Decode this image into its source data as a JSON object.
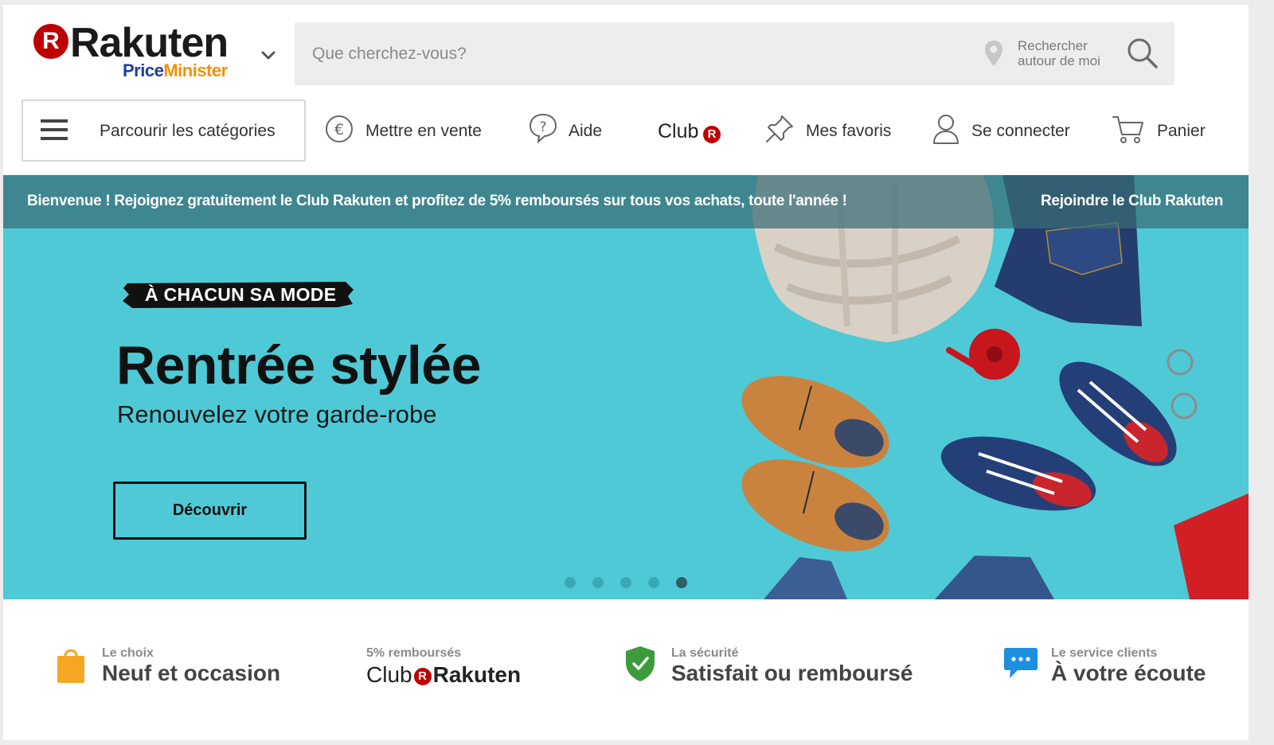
{
  "brand": {
    "logo_letter": "R",
    "logo_word": "Rakuten",
    "sub_part1": "Price",
    "sub_part2": "Minister",
    "colors": {
      "red": "#bf0000",
      "blue": "#1e3ea0",
      "orange": "#f29100",
      "banner": "#4fc9d6"
    }
  },
  "search": {
    "placeholder": "Que cherchez-vous?",
    "geo_line1": "Rechercher",
    "geo_line2": "autour de moi",
    "geo_icon": "location-pin-icon",
    "button_icon": "search-icon"
  },
  "nav": {
    "browse_label": "Parcourir les catégories",
    "sell_label": "Mettre en vente",
    "help_label": "Aide",
    "club_label": "Club",
    "club_letter": "R",
    "favorites_label": "Mes favoris",
    "login_label": "Se connecter",
    "cart_label": "Panier"
  },
  "promo": {
    "text": "Bienvenue ! Rejoignez gratuitement le Club Rakuten et profitez de 5% remboursés sur tous vos achats, toute l'année !",
    "link": "Rejoindre le Club Rakuten"
  },
  "hero": {
    "tag": "À CHACUN SA MODE",
    "title": "Rentrée stylée",
    "subtitle": "Renouvelez votre garde-robe",
    "cta": "Découvrir",
    "slides_total": 5,
    "active_slide": 5
  },
  "features": [
    {
      "small": "Le choix",
      "big": "Neuf et occasion",
      "icon": "shopping-bag-icon"
    },
    {
      "small": "5% remboursés",
      "club_word": "Club",
      "club_letter": "R",
      "club_brand": "Rakuten"
    },
    {
      "small": "La sécurité",
      "big": "Satisfait ou remboursé",
      "icon": "shield-check-icon"
    },
    {
      "small": "Le service clients",
      "big": "À votre écoute",
      "icon": "chat-bubble-icon"
    }
  ]
}
